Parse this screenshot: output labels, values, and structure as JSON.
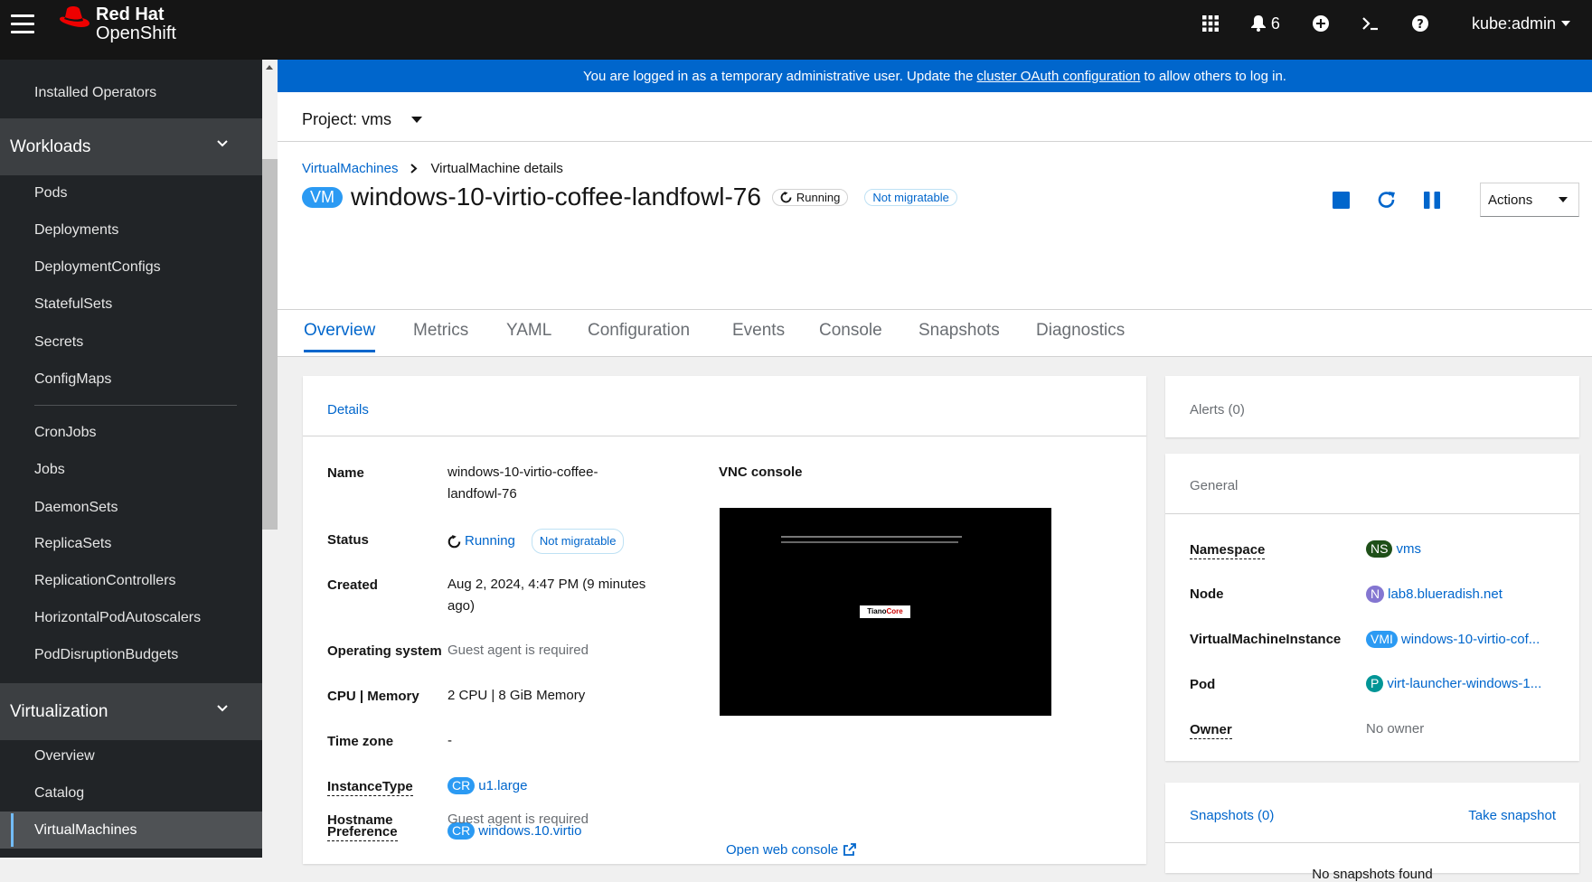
{
  "masthead": {
    "brand_line1": "Red Hat",
    "brand_line2": "OpenShift",
    "notifications_count": "6",
    "user": "kube:admin"
  },
  "sidebar": {
    "top_item": "Installed Operators",
    "workloads_label": "Workloads",
    "workloads_items": [
      "Pods",
      "Deployments",
      "DeploymentConfigs",
      "StatefulSets",
      "Secrets",
      "ConfigMaps"
    ],
    "workloads_items_2": [
      "CronJobs",
      "Jobs",
      "DaemonSets",
      "ReplicaSets",
      "ReplicationControllers",
      "HorizontalPodAutoscalers",
      "PodDisruptionBudgets"
    ],
    "virtualization_label": "Virtualization",
    "virtualization_items": [
      "Overview",
      "Catalog",
      "VirtualMachines"
    ]
  },
  "banner": {
    "text_before": "You are logged in as a temporary administrative user. Update the",
    "link": "cluster OAuth configuration",
    "text_after": "to allow others to log in."
  },
  "project": {
    "label": "Project: vms"
  },
  "breadcrumb": {
    "parent": "VirtualMachines",
    "current": "VirtualMachine details"
  },
  "vm": {
    "badge": "VM",
    "name": "windows-10-virtio-coffee-landfowl-76",
    "status": "Running",
    "migratable": "Not migratable"
  },
  "actions": {
    "label": "Actions"
  },
  "tabs": [
    "Overview",
    "Metrics",
    "YAML",
    "Configuration",
    "Events",
    "Console",
    "Snapshots",
    "Diagnostics"
  ],
  "details": {
    "title": "Details",
    "name_label": "Name",
    "name_line1": "windows-10-virtio-coffee-",
    "name_line2": "landfowl-76",
    "status_label": "Status",
    "status_value": "Running",
    "status_migratable": "Not migratable",
    "created_label": "Created",
    "created_line1": "Aug 2, 2024, 4:47 PM (9 minutes",
    "created_line2": "ago)",
    "os_label": "Operating system",
    "os_value": "Guest agent is required",
    "cpu_label": "CPU | Memory",
    "cpu_value": "2 CPU | 8 GiB Memory",
    "tz_label": "Time zone",
    "tz_value": "-",
    "instancetype_label": "InstanceType",
    "instancetype_badge": "CR",
    "instancetype_value": "u1.large",
    "preference_label": "Preference",
    "preference_badge": "CR",
    "preference_value": "windows.10.virtio",
    "hostname_label": "Hostname",
    "hostname_value": "Guest agent is required",
    "vnc_label": "VNC console",
    "vnc_logo_a": "Tiano",
    "vnc_logo_b": "Core",
    "open_console": "Open web console"
  },
  "alerts": {
    "title": "Alerts (0)"
  },
  "general": {
    "title": "General",
    "namespace_label": "Namespace",
    "namespace_badge": "NS",
    "namespace_value": "vms",
    "node_label": "Node",
    "node_badge": "N",
    "node_value": "lab8.blueradish.net",
    "vmi_label": "VirtualMachineInstance",
    "vmi_badge": "VMI",
    "vmi_value": "windows-10-virtio-cof...",
    "pod_label": "Pod",
    "pod_badge": "P",
    "pod_value": "virt-launcher-windows-1...",
    "owner_label": "Owner",
    "owner_value": "No owner"
  },
  "snapshots": {
    "title": "Snapshots (0)",
    "take": "Take snapshot",
    "empty": "No snapshots found"
  },
  "colors": {
    "masthead": "#151515",
    "sidebar": "#212427",
    "banner": "#0066cc",
    "link": "#0066cc",
    "vm_badge": "#2b9af3",
    "ns_badge": "#3e8635",
    "node_badge": "#8476d1",
    "pod_badge": "#009596"
  }
}
